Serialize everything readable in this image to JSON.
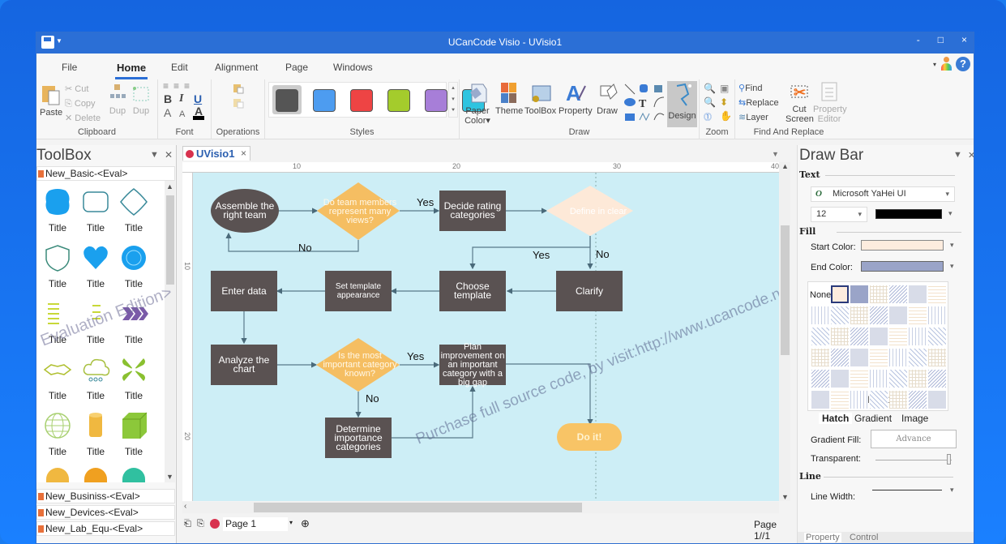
{
  "window": {
    "title": "UCanCode Visio - UVisio1",
    "controls": {
      "minimize": "-",
      "maximize": "□",
      "close": "×"
    }
  },
  "menu": {
    "tabs": [
      {
        "label": "File",
        "active": false
      },
      {
        "label": "Home",
        "active": true
      },
      {
        "label": "Edit",
        "active": false
      },
      {
        "label": "Alignment",
        "active": false
      },
      {
        "label": "Page",
        "active": false
      },
      {
        "label": "Windows",
        "active": false
      }
    ],
    "help_label": "?"
  },
  "ribbon": {
    "clipboard": {
      "label": "Clipboard",
      "paste": "Paste",
      "cut": "Cut",
      "copy": "Copy",
      "delete": "Delete",
      "dup1": "Dup",
      "dup2": "Dup"
    },
    "font": {
      "label": "Font",
      "bold": "B",
      "italic": "I",
      "underline": "U",
      "grow": "A",
      "shrink": "A",
      "color": "A"
    },
    "operations": {
      "label": "Operations"
    },
    "styles": {
      "label": "Styles",
      "swatches": [
        "#555555",
        "#4d9cf0",
        "#ee4444",
        "#a4cc2c",
        "#a77ed8",
        "#2ec4e0"
      ],
      "selected_index": 0
    },
    "draw": {
      "label": "Draw",
      "paper_color": "Paper Color▾",
      "theme": "Theme",
      "toolbox": "ToolBox",
      "property": "Property",
      "draw": "Draw",
      "design": "Design"
    },
    "zoom": {
      "label": "Zoom"
    },
    "find_replace": {
      "label": "Find And Replace",
      "find": "Find",
      "replace": "Replace",
      "layer": "Layer",
      "cut_screen_1": "Cut",
      "cut_screen_2": "Screen",
      "property_editor_1": "Property",
      "property_editor_2": "Editor"
    }
  },
  "toolbox": {
    "title": "ToolBox",
    "library": "New_Basic-<Eval>",
    "shapes": [
      {
        "label": "Title",
        "kind": "blob"
      },
      {
        "label": "Title",
        "kind": "rounded-rect"
      },
      {
        "label": "Title",
        "kind": "curved-square"
      },
      {
        "label": "Title",
        "kind": "shield"
      },
      {
        "label": "Title",
        "kind": "heart"
      },
      {
        "label": "Title",
        "kind": "flower"
      },
      {
        "label": "Title",
        "kind": "lines"
      },
      {
        "label": "Title",
        "kind": "dashes"
      },
      {
        "label": "Title",
        "kind": "chevrons"
      },
      {
        "label": "Title",
        "kind": "zigzag"
      },
      {
        "label": "Title",
        "kind": "cloud"
      },
      {
        "label": "Title",
        "kind": "propeller"
      },
      {
        "label": "Title",
        "kind": "globe"
      },
      {
        "label": "Title",
        "kind": "cylinder"
      },
      {
        "label": "Title",
        "kind": "cube"
      }
    ],
    "other_libraries": [
      "New_Businiss-<Eval>",
      "New_Devices-<Eval>",
      "New_Lab_Equ-<Eval>"
    ],
    "watermark": "Evaluation Edition>"
  },
  "document": {
    "tab_label": "UVisio1",
    "ruler_h": [
      "10",
      "20",
      "30",
      "40"
    ],
    "ruler_v": [
      "10",
      "20"
    ],
    "nodes": {
      "assemble": "Assemble the right team",
      "team_views": "Do team members represent many views?",
      "decide": "Decide rating categories",
      "define": "Define in clear",
      "choose": "Choose template",
      "clarify": "Clarify",
      "set_template": "Set template appearance",
      "enter": "Enter data",
      "analyze": "Analyze the chart",
      "important": "Is the most important category known?",
      "plan": "Plan improvement on an important category with a big gap",
      "determine": "Determine importance categories",
      "doit": "Do it!"
    },
    "edge_labels": {
      "yes1": "Yes",
      "no1": "No",
      "yes2": "Yes",
      "no2": "No",
      "yes3": "Yes",
      "no3": "No"
    },
    "watermark": "Purchase full source code, by visit:http://www.ucancode.net!",
    "page_selector": "Page  1",
    "page_indicator": "Page 1//1"
  },
  "drawbar": {
    "title": "Draw Bar",
    "text_section": "Text",
    "font_name": "Microsoft YaHei UI",
    "font_size": "12",
    "text_color": "#000000",
    "fill_section": "Fill",
    "start_color_label": "Start Color:",
    "start_color": "#fdecde",
    "end_color_label": "End Color:",
    "end_color": "#9aa4c8",
    "hatch_none": "None",
    "hatch_selected": "Hatch1",
    "fill_tabs": [
      "Hatch",
      "Gradient",
      "Image"
    ],
    "gradient_fill_label": "Gradient Fill:",
    "advance_button": "Advance",
    "transparent_label": "Transparent:",
    "transparency": 1.0,
    "line_section": "Line",
    "line_width_label": "Line Width:",
    "bottom_tabs": [
      "Property",
      "Control"
    ]
  }
}
